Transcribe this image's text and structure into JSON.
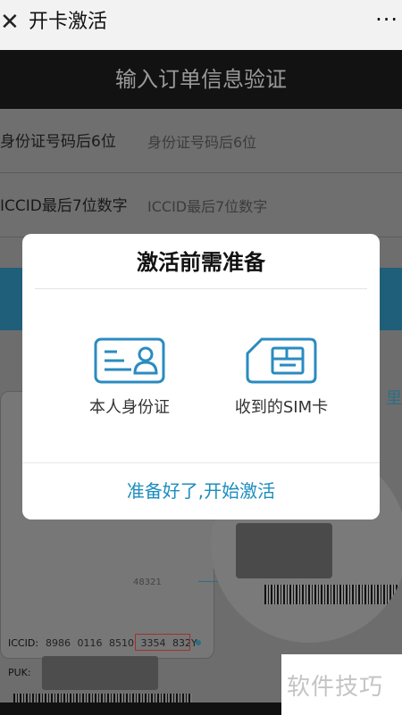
{
  "topbar": {
    "close_icon": "close-icon",
    "close_glyph": "✕",
    "title": "开卡激活",
    "more_glyph": "···"
  },
  "header": {
    "title": "输入订单信息验证"
  },
  "form": {
    "id_label": "身份证号码后6位",
    "id_placeholder": "身份证号码后6位",
    "iccid_label": "ICCID最后7位数字",
    "iccid_placeholder": "ICCID最后7位数字"
  },
  "background": {
    "side_text": "里",
    "card_number": "48321",
    "iccid_label": "ICCID:",
    "iccid_value": "8986 0116 8510 3354 832Y",
    "puk_label": "PUK:"
  },
  "modal": {
    "title": "激活前需准备",
    "items": [
      {
        "label": "本人身份证",
        "icon": "id-card-icon"
      },
      {
        "label": "收到的SIM卡",
        "icon": "sim-card-icon"
      }
    ],
    "action": "准备好了,开始激活"
  },
  "watermark": {
    "text": "软件技巧"
  },
  "colors": {
    "accent": "#1c8dbf",
    "icon_blue": "#2a8bc0"
  }
}
